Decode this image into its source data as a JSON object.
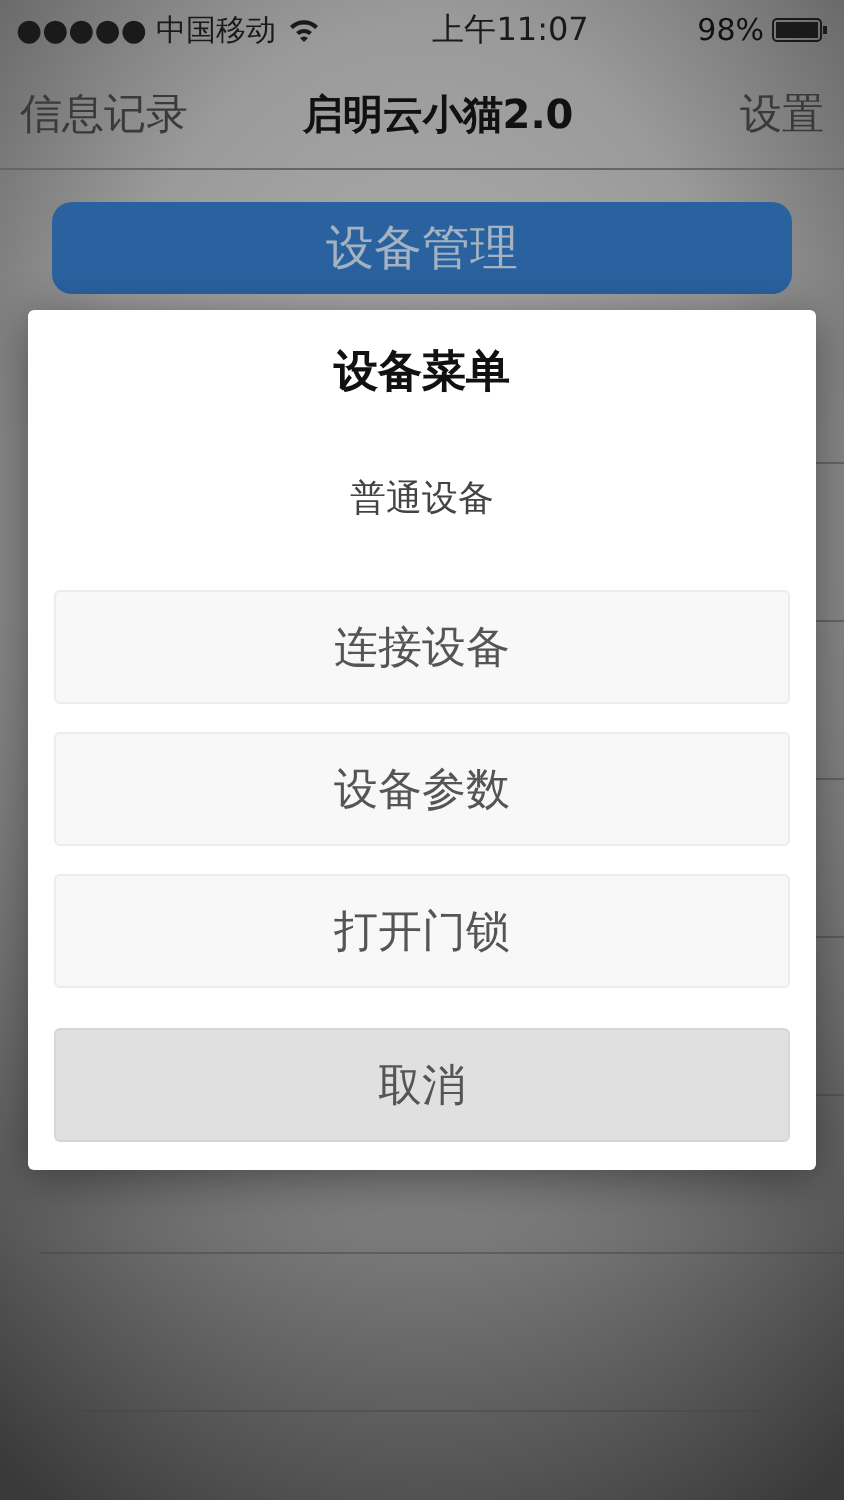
{
  "status_bar": {
    "carrier": "●●●●● 中国移动",
    "time": "上午11:07",
    "battery": "98%"
  },
  "nav": {
    "left": "信息记录",
    "title": "启明云小猫2.0",
    "right": "设置"
  },
  "main_button": "设备管理",
  "dialog": {
    "title": "设备菜单",
    "subtitle": "普通设备",
    "buttons": [
      {
        "label": "连接设备",
        "kind": "option"
      },
      {
        "label": "设备参数",
        "kind": "option"
      },
      {
        "label": "打开门锁",
        "kind": "option"
      },
      {
        "label": "取消",
        "kind": "cancel"
      }
    ]
  }
}
